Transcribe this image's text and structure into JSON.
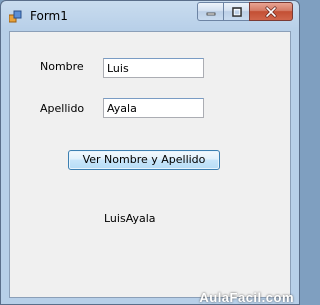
{
  "window": {
    "title": "Form1"
  },
  "caption_buttons": {
    "minimize_icon": "minimize-icon",
    "maximize_icon": "maximize-icon",
    "close_icon": "close-icon"
  },
  "form": {
    "nombre_label": "Nombre",
    "nombre_value": "Luis",
    "apellido_label": "Apellido",
    "apellido_value": "Ayala",
    "button_label": "Ver Nombre  y Apellido",
    "result_text": "LuisAyala"
  },
  "watermark": "AulaFacil.com",
  "colors": {
    "title_bar": "#b7cfe8",
    "close_button": "#c34f34",
    "client_background": "#f0f0f0"
  }
}
